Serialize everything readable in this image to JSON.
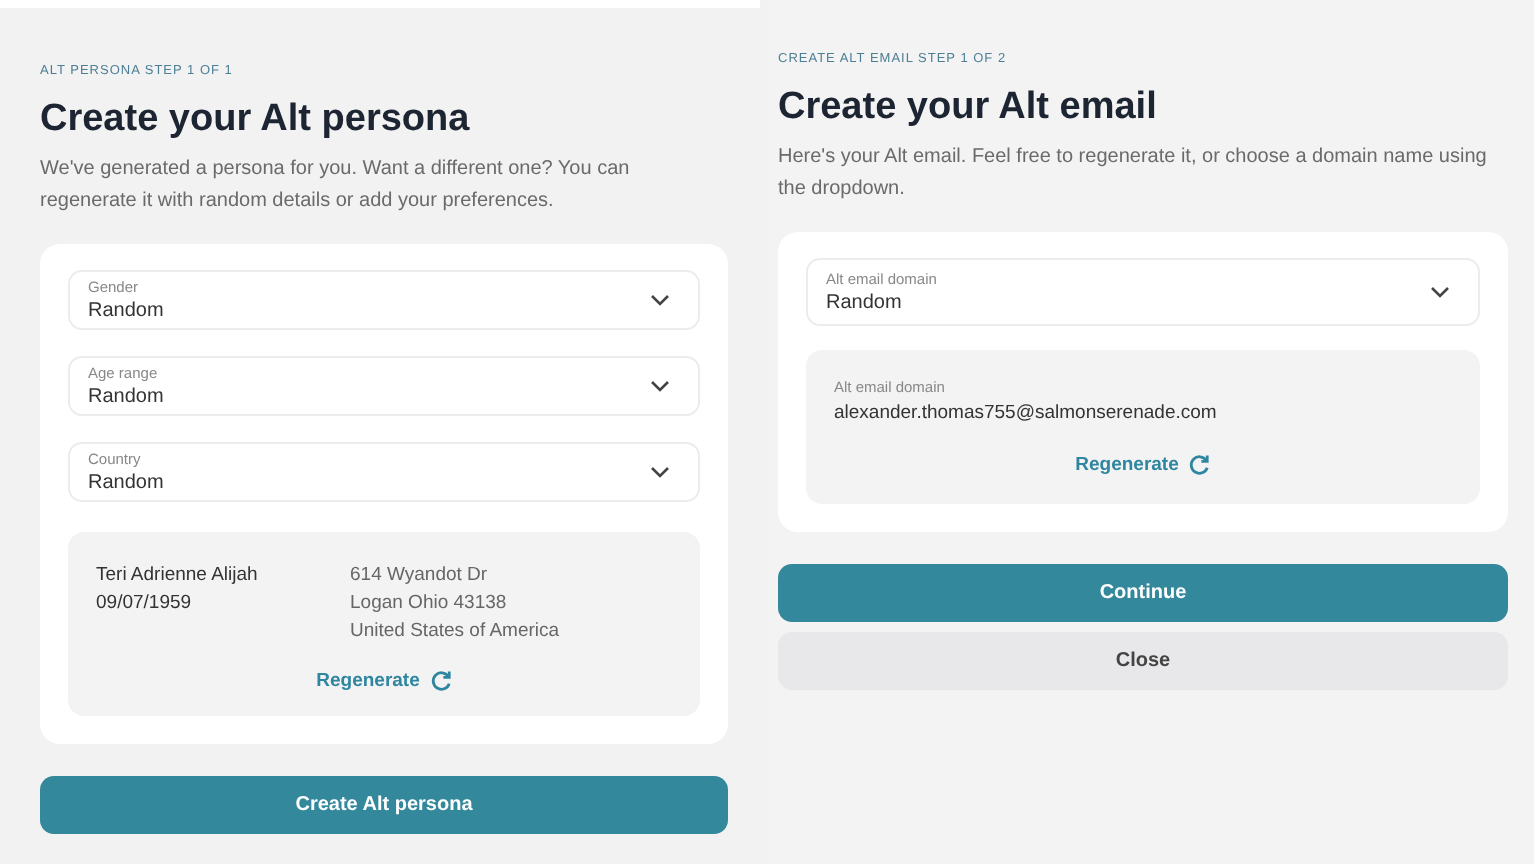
{
  "persona_panel": {
    "step": "ALT PERSONA STEP 1 OF 1",
    "title": "Create your Alt persona",
    "description": "We've generated a persona for you. Want a different one? You can regenerate it with random details or add your preferences.",
    "selects": [
      {
        "label": "Gender",
        "value": "Random"
      },
      {
        "label": "Age range",
        "value": "Random"
      },
      {
        "label": "Country",
        "value": "Random"
      }
    ],
    "persona": {
      "name": "Teri Adrienne Alijah",
      "birthdate": "09/07/1959",
      "address": [
        "614 Wyandot Dr",
        "Logan Ohio 43138",
        "United States of America"
      ]
    },
    "regenerate": "Regenerate",
    "buttons": [
      {
        "label": "Create Alt persona",
        "kind": "primary"
      }
    ]
  },
  "email_panel": {
    "step": "CREATE ALT EMAIL STEP 1 OF 2",
    "title": "Create your Alt email",
    "description": "Here's your Alt email. Feel free to regenerate it, or choose a domain name using the dropdown.",
    "selects": [
      {
        "label": "Alt email domain",
        "value": "Random"
      }
    ],
    "email": {
      "label": "Alt email domain",
      "value": "alexander.thomas755@salmonserenade.com"
    },
    "regenerate": "Regenerate",
    "buttons": [
      {
        "label": "Continue",
        "kind": "primary"
      },
      {
        "label": "Close",
        "kind": "secondary"
      }
    ]
  }
}
